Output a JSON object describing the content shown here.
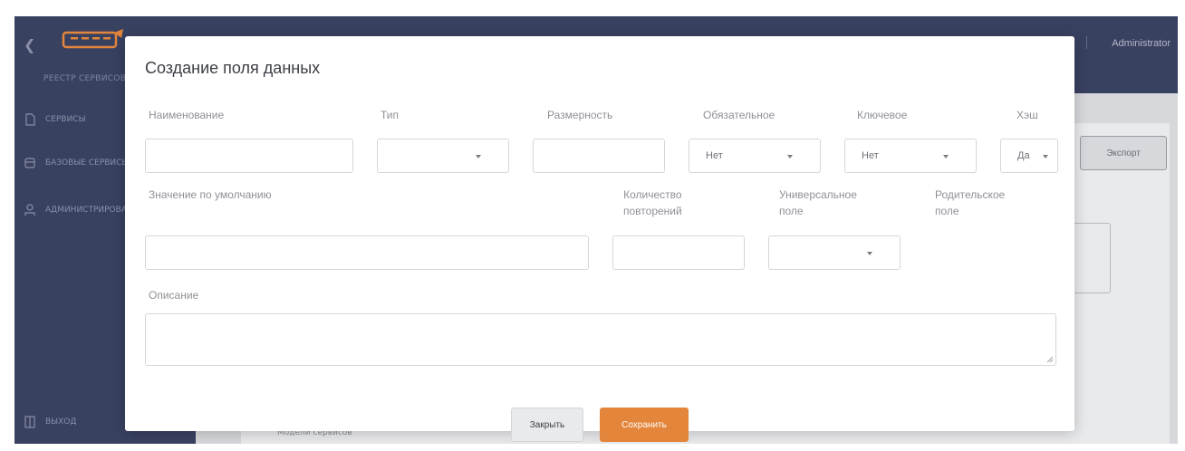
{
  "app": {
    "subtitle": "РЕЕСТР СЕРВИСОВ",
    "user": "Administrator",
    "brand_color": "#e3853a"
  },
  "sidebar": {
    "items": [
      {
        "label": "СЕРВИСЫ",
        "icon": "file-icon"
      },
      {
        "label": "БАЗОВЫЕ СЕРВИСЫ",
        "icon": "database-icon"
      },
      {
        "label": "АДМИНИСТРИРОВАНИЕ",
        "icon": "user-admin-icon"
      }
    ],
    "logout": {
      "label": "ВЫХОД",
      "icon": "logout-icon"
    }
  },
  "background": {
    "export_label": "Экспорт",
    "content_text": "Модели сервисов"
  },
  "modal": {
    "title": "Создание поля данных",
    "fields": {
      "name": {
        "label": "Наименование",
        "value": ""
      },
      "type": {
        "label": "Тип",
        "value": ""
      },
      "dimension": {
        "label": "Размерность",
        "value": ""
      },
      "required": {
        "label": "Обязательное",
        "value": "Нет"
      },
      "key": {
        "label": "Ключевое",
        "value": "Нет"
      },
      "hash": {
        "label": "Хэш",
        "value": "Да"
      },
      "default_value": {
        "label": "Значение по умолчанию",
        "value": ""
      },
      "repeat_count": {
        "label_line1": "Количество",
        "label_line2": "повторений",
        "value": ""
      },
      "universal": {
        "label_line1": "Универсальное",
        "label_line2": "поле",
        "value": ""
      },
      "parent": {
        "label_line1": "Родительское",
        "label_line2": "поле"
      },
      "description": {
        "label": "Описание",
        "value": ""
      }
    },
    "buttons": {
      "close": "Закрыть",
      "save": "Сохранить"
    }
  }
}
